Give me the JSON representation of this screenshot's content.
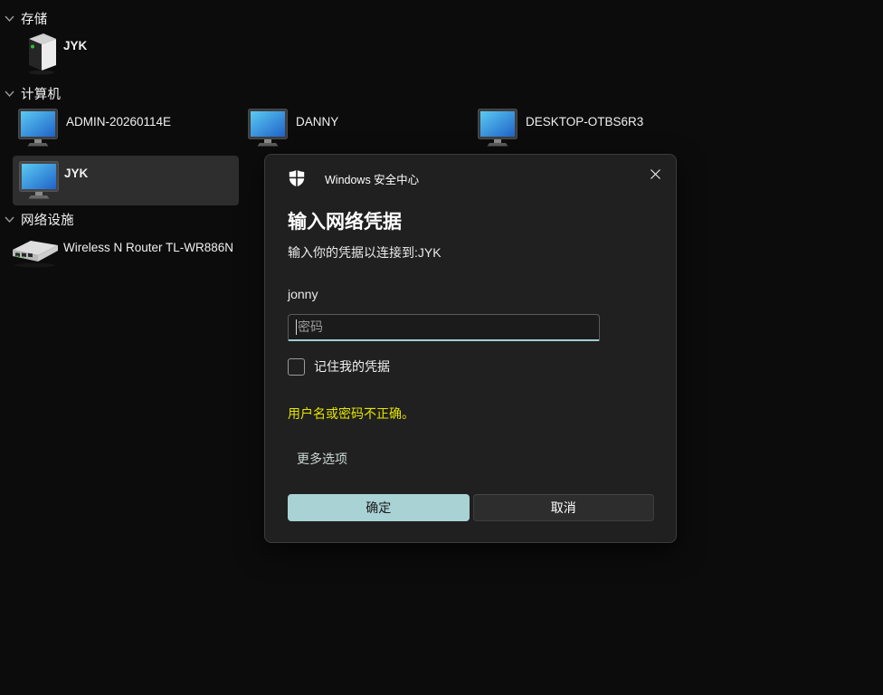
{
  "network_browser": {
    "sections": {
      "storage": {
        "label": "存储"
      },
      "computers": {
        "label": "计算机"
      },
      "network_devices": {
        "label": "网络设施"
      }
    },
    "storage_items": [
      {
        "label": "JYK",
        "icon": "nas-storage-icon"
      }
    ],
    "computer_items": [
      {
        "label": "ADMIN-20260114E",
        "icon": "monitor-icon",
        "selected": false
      },
      {
        "label": "DANNY",
        "icon": "monitor-icon",
        "selected": false
      },
      {
        "label": "DESKTOP-OTBS6R3",
        "icon": "monitor-icon",
        "selected": false
      },
      {
        "label": "JYK",
        "icon": "monitor-icon",
        "selected": true
      }
    ],
    "network_items": [
      {
        "label": "Wireless N Router TL-WR886N",
        "icon": "router-icon"
      }
    ]
  },
  "dialog": {
    "app_title": "Windows 安全中心",
    "title": "输入网络凭据",
    "subtitle": "输入你的凭据以连接到:JYK",
    "username": "jonny",
    "password_value": "",
    "password_placeholder": "密码",
    "remember_label": "记住我的凭据",
    "remember_checked": false,
    "error_message": "用户名或密码不正确。",
    "more_options_label": "更多选项",
    "ok_label": "确定",
    "cancel_label": "取消"
  },
  "colors": {
    "page_background": "#0c0c0c",
    "dialog_background": "#202020",
    "selection_background": "#2e2e2e",
    "accent_button": "#a9d2d5",
    "input_underline": "#a3ccd1",
    "error_text": "#e5e500",
    "link_text": "#cbd9d3"
  }
}
